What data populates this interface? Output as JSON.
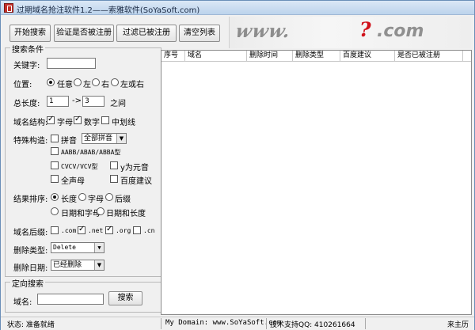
{
  "window": {
    "title": "过期域名抢注软件1.2——索雅软件(SoYaSoft.com)"
  },
  "toolbar": {
    "start_label": "开始搜索",
    "verify_label": "验证是否被注册",
    "filter_label": "过滤已被注册",
    "clear_label": "清空列表"
  },
  "banner": {
    "text_left": "www.",
    "text_mark": "?",
    "text_right": ".com"
  },
  "search": {
    "legend": "搜索条件",
    "keyword_label": "关键字:",
    "keyword_value": "",
    "position_label": "位置:",
    "position_options": [
      "任意",
      "左",
      "右",
      "左或右"
    ],
    "position_selected": "任意",
    "length_label": "总长度:",
    "length_min": "1",
    "length_sep": "->",
    "length_max": "3",
    "length_suffix": "之间",
    "structure_label": "域名结构:",
    "structure_options": [
      {
        "label": "字母",
        "checked": true
      },
      {
        "label": "数字",
        "checked": true
      },
      {
        "label": "中划线",
        "checked": false
      }
    ],
    "special_label": "特殊构造:",
    "special_pinyin": "拼音",
    "pinyin_select": "全部拼音",
    "special_aabb": "AABB/ABAB/ABBA型",
    "special_cvcv": "CVCV/VCV型",
    "special_y_vowel": "y为元音",
    "special_allvowel": "全声母",
    "special_baidu": "百度建议",
    "sort_label": "结果排序:",
    "sort_options": [
      "长度",
      "字母",
      "后缀",
      "日期和字母",
      "日期和长度"
    ],
    "sort_selected": "长度",
    "suffix_label": "域名后缀:",
    "suffix_options": [
      {
        "label": ".com",
        "checked": false
      },
      {
        "label": ".net",
        "checked": true
      },
      {
        "label": ".org",
        "checked": true
      },
      {
        "label": ".cn",
        "checked": false
      }
    ],
    "delete_type_label": "删除类型:",
    "delete_type_value": "Delete",
    "delete_date_label": "删除日期:",
    "delete_date_value": "已经删除"
  },
  "direct": {
    "legend": "定向搜索",
    "domain_label": "域名:",
    "domain_value": "",
    "search_label": "搜索"
  },
  "table": {
    "columns": [
      "序号",
      "域名",
      "删除时间",
      "删除类型",
      "百度建议",
      "是否已被注册"
    ]
  },
  "status": {
    "state": "状态: 准备就绪",
    "domain": "My Domain: www.SoYaSoft.com",
    "qq": "技术支持QQ: 410261664",
    "author": "来主历"
  }
}
